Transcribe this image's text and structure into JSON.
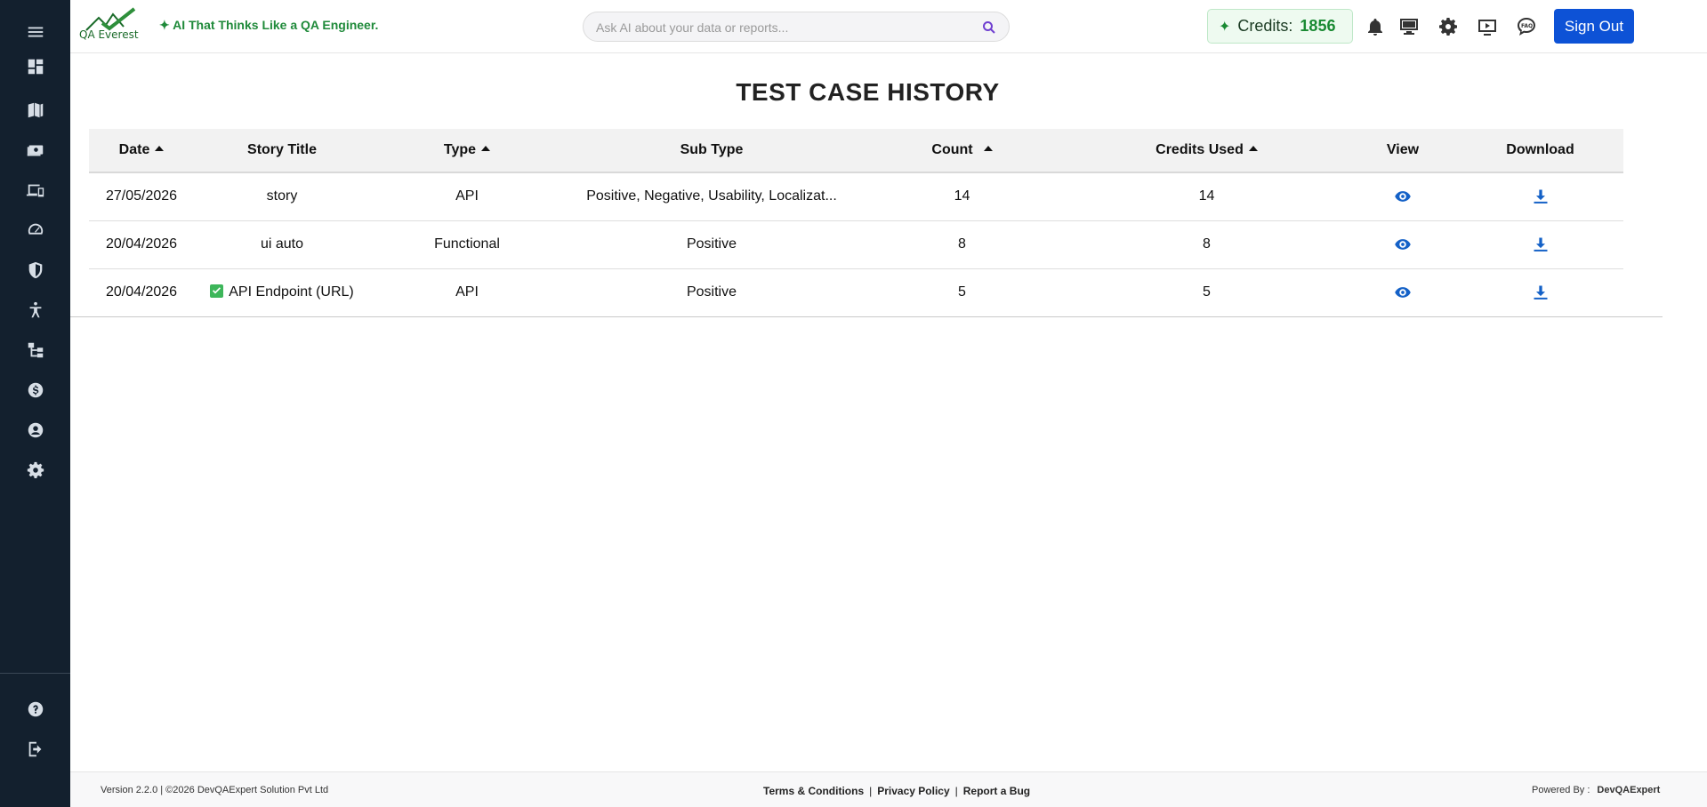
{
  "header": {
    "logo_text": "QA Everest",
    "tagline": "✦ AI That Thinks Like a QA Engineer.",
    "search_placeholder": "Ask AI about your data or reports...",
    "credits_star": "✦",
    "credits_label": "Credits:",
    "credits_value": "1856",
    "signout_label": "Sign Out",
    "icons": [
      "bell-icon",
      "keyboard-icon",
      "gear-icon",
      "play-video-icon",
      "faq-icon"
    ]
  },
  "sidebar": {
    "icons": [
      "menu-icon",
      "dashboard-icon",
      "book-icon",
      "money-icon",
      "devices-icon",
      "speedometer-icon",
      "shield-icon",
      "accessibility-icon",
      "hierarchy-icon",
      "dollar-icon",
      "user-icon",
      "settings-icon",
      "help-icon",
      "logout-icon"
    ]
  },
  "main": {
    "title": "TEST CASE HISTORY",
    "columns": [
      "Date",
      "Story Title",
      "Type",
      "Sub Type",
      "Count",
      "Credits Used",
      "View",
      "Download"
    ],
    "rows": [
      {
        "date": "27/05/2026",
        "story_title": "story",
        "type": "API",
        "sub_type": "Positive, Negative, Usability, Localizat...",
        "count": "14",
        "credits_used": "14"
      },
      {
        "date": "20/04/2026",
        "story_title": "ui auto",
        "type": "Functional",
        "sub_type": "Positive",
        "count": "8",
        "credits_used": "8"
      },
      {
        "date": "20/04/2026",
        "story_title": "API Endpoint (URL)",
        "type": "API",
        "sub_type": "Positive",
        "count": "5",
        "credits_used": "5"
      }
    ]
  },
  "footer": {
    "left": "Version 2.2.0   |   ©2026 DevQAExpert Solution Pvt Ltd",
    "terms": "Terms & Conditions",
    "privacy": "Privacy Policy",
    "report_bug": "Report a Bug",
    "powered_by_label": "Powered By :",
    "powered_by": "DevQAExpert"
  },
  "colors": {
    "sidebar_bg": "#13202e",
    "accent_blue": "#0d52d6",
    "brand_green": "#1a8a33"
  }
}
